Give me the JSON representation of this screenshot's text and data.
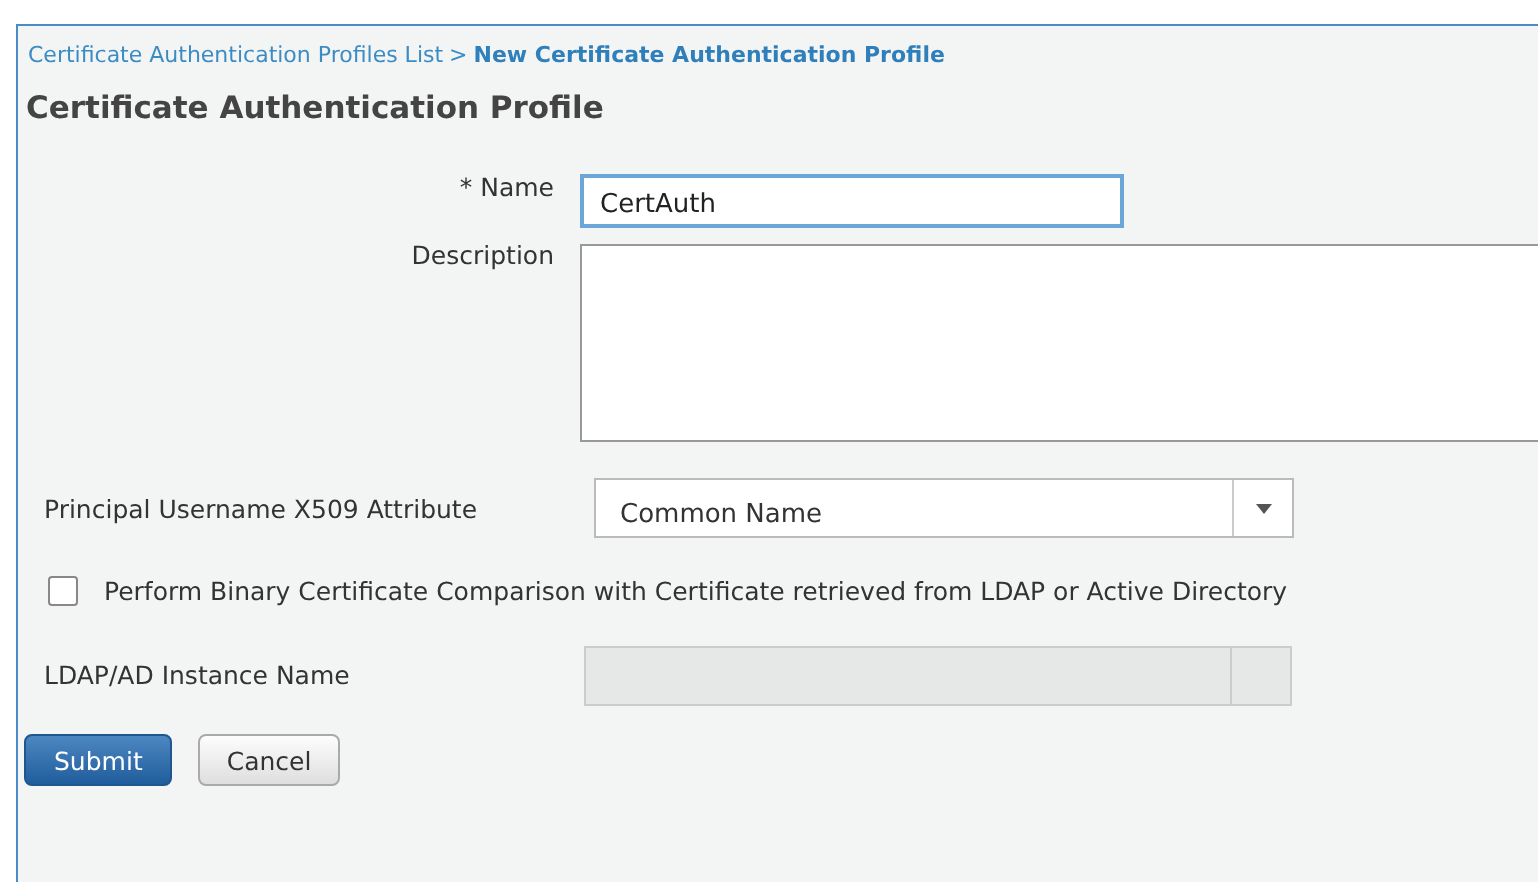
{
  "breadcrumb": {
    "link": "Certificate Authentication Profiles List",
    "separator": ">",
    "current": "New Certificate Authentication Profile"
  },
  "title": "Certificate Authentication Profile",
  "fields": [
    {
      "kind": "text",
      "label": "* Name",
      "value": "CertAuth",
      "focused": true
    },
    {
      "kind": "textarea",
      "label": "Description"
    },
    {
      "kind": "select",
      "label": "Principal Username X509 Attribute",
      "value": "Common Name",
      "disabled": false
    },
    {
      "kind": "checkbox",
      "label": "Perform Binary Certificate Comparison with Certificate retrieved from LDAP or Active Directory",
      "checked": false
    },
    {
      "kind": "select",
      "label": "LDAP/AD Instance Name",
      "disabled": true
    }
  ],
  "buttons": [
    {
      "label": "Submit",
      "kind": "primary"
    },
    {
      "label": "Cancel",
      "kind": "default"
    }
  ]
}
